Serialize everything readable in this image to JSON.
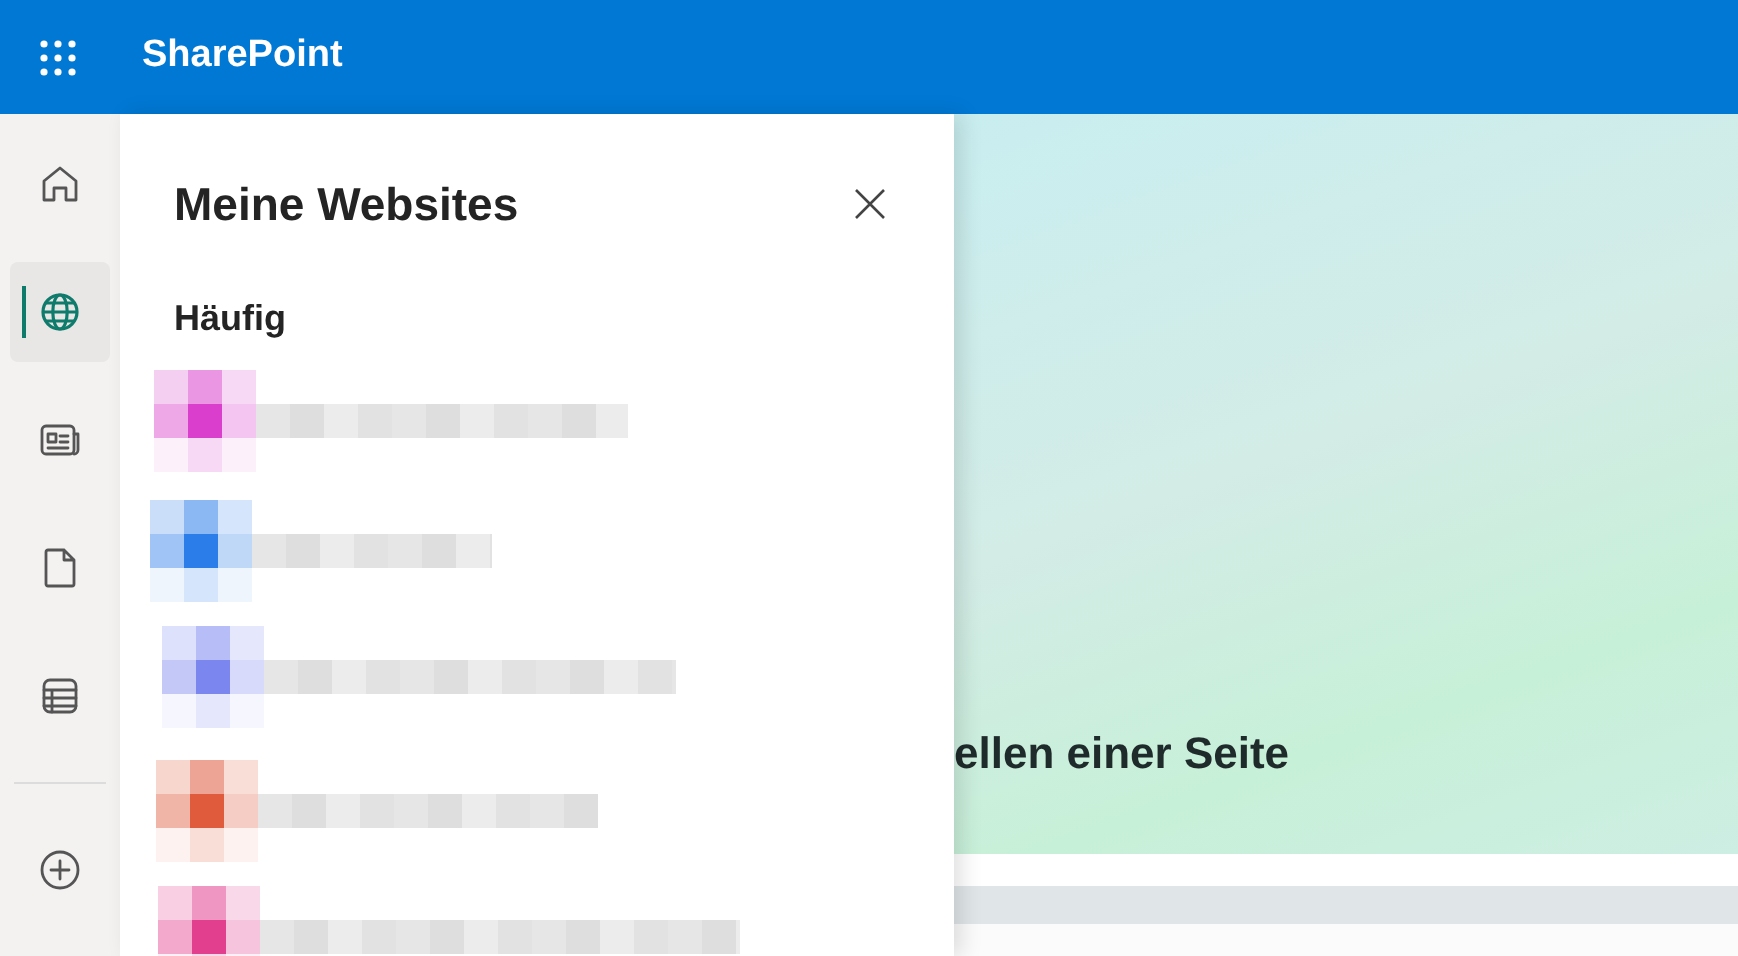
{
  "app_bar": {
    "title": "SharePoint"
  },
  "nav_rail": [
    {
      "kind": "home",
      "selected": false
    },
    {
      "kind": "globe",
      "selected": true
    },
    {
      "kind": "news",
      "selected": false
    },
    {
      "kind": "file",
      "selected": false
    },
    {
      "kind": "list",
      "selected": false
    },
    {
      "kind": "add",
      "selected": false
    }
  ],
  "panel": {
    "title": "Meine Websites",
    "section": "Häufig",
    "sites": [
      {
        "color": "#d93fcc"
      },
      {
        "color": "#2b7de9"
      },
      {
        "color": "#7b86ee"
      },
      {
        "color": "#e05a3c"
      },
      {
        "color": "#e2408f"
      }
    ]
  },
  "hero": {
    "heading": "ellen einer Seite"
  }
}
